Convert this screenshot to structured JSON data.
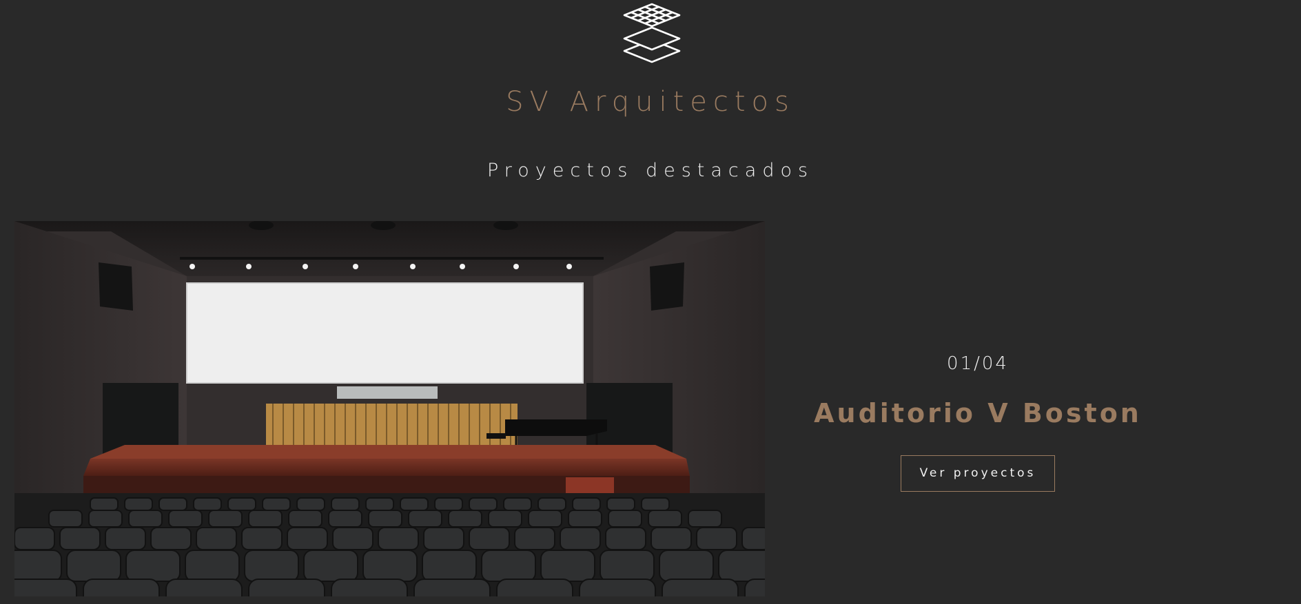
{
  "header": {
    "logo_icon": "layered-grid-logo-icon",
    "brand_name": "SV Arquitectos"
  },
  "section": {
    "title": "Proyectos destacados"
  },
  "slider": {
    "counter": "01/04",
    "project_title": "Auditorio V Boston",
    "button_label": "Ver proyectos",
    "image_description_icon": "auditorium-photo"
  },
  "colors": {
    "background": "#292929",
    "accent": "#9a7b60",
    "text_light": "#f2f2f2"
  }
}
